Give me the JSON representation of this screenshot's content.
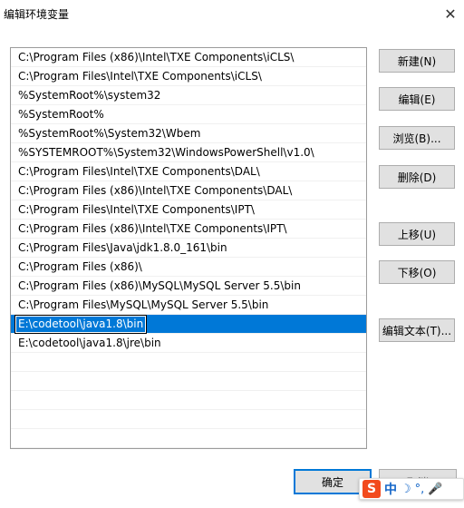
{
  "window": {
    "title": "编辑环境变量",
    "close_glyph": "✕"
  },
  "paths": [
    "C:\\Program Files (x86)\\Intel\\TXE Components\\iCLS\\",
    "C:\\Program Files\\Intel\\TXE Components\\iCLS\\",
    "%SystemRoot%\\system32",
    "%SystemRoot%",
    "%SystemRoot%\\System32\\Wbem",
    "%SYSTEMROOT%\\System32\\WindowsPowerShell\\v1.0\\",
    "C:\\Program Files\\Intel\\TXE Components\\DAL\\",
    "C:\\Program Files (x86)\\Intel\\TXE Components\\DAL\\",
    "C:\\Program Files\\Intel\\TXE Components\\IPT\\",
    "C:\\Program Files (x86)\\Intel\\TXE Components\\IPT\\",
    "C:\\Program Files\\Java\\jdk1.8.0_161\\bin",
    "C:\\Program Files (x86)\\",
    "C:\\Program Files (x86)\\MySQL\\MySQL Server 5.5\\bin",
    "C:\\Program Files\\MySQL\\MySQL Server 5.5\\bin",
    "E:\\codetool\\java1.8\\bin",
    "E:\\codetool\\java1.8\\jre\\bin"
  ],
  "selected_index": 14,
  "buttons": {
    "new": "新建(N)",
    "edit": "编辑(E)",
    "browse": "浏览(B)...",
    "delete": "删除(D)",
    "move_up": "上移(U)",
    "move_down": "下移(O)",
    "edit_text": "编辑文本(T)..."
  },
  "footer": {
    "ok": "确定",
    "cancel": "取消"
  },
  "ime": {
    "logo": "S",
    "lang": "中",
    "moon": "☽",
    "dot": "°,",
    "mic": "🎤"
  },
  "colors": {
    "selection": "#0078d7",
    "ime_logo": "#f24a1d",
    "ime_text": "#1466c8"
  }
}
